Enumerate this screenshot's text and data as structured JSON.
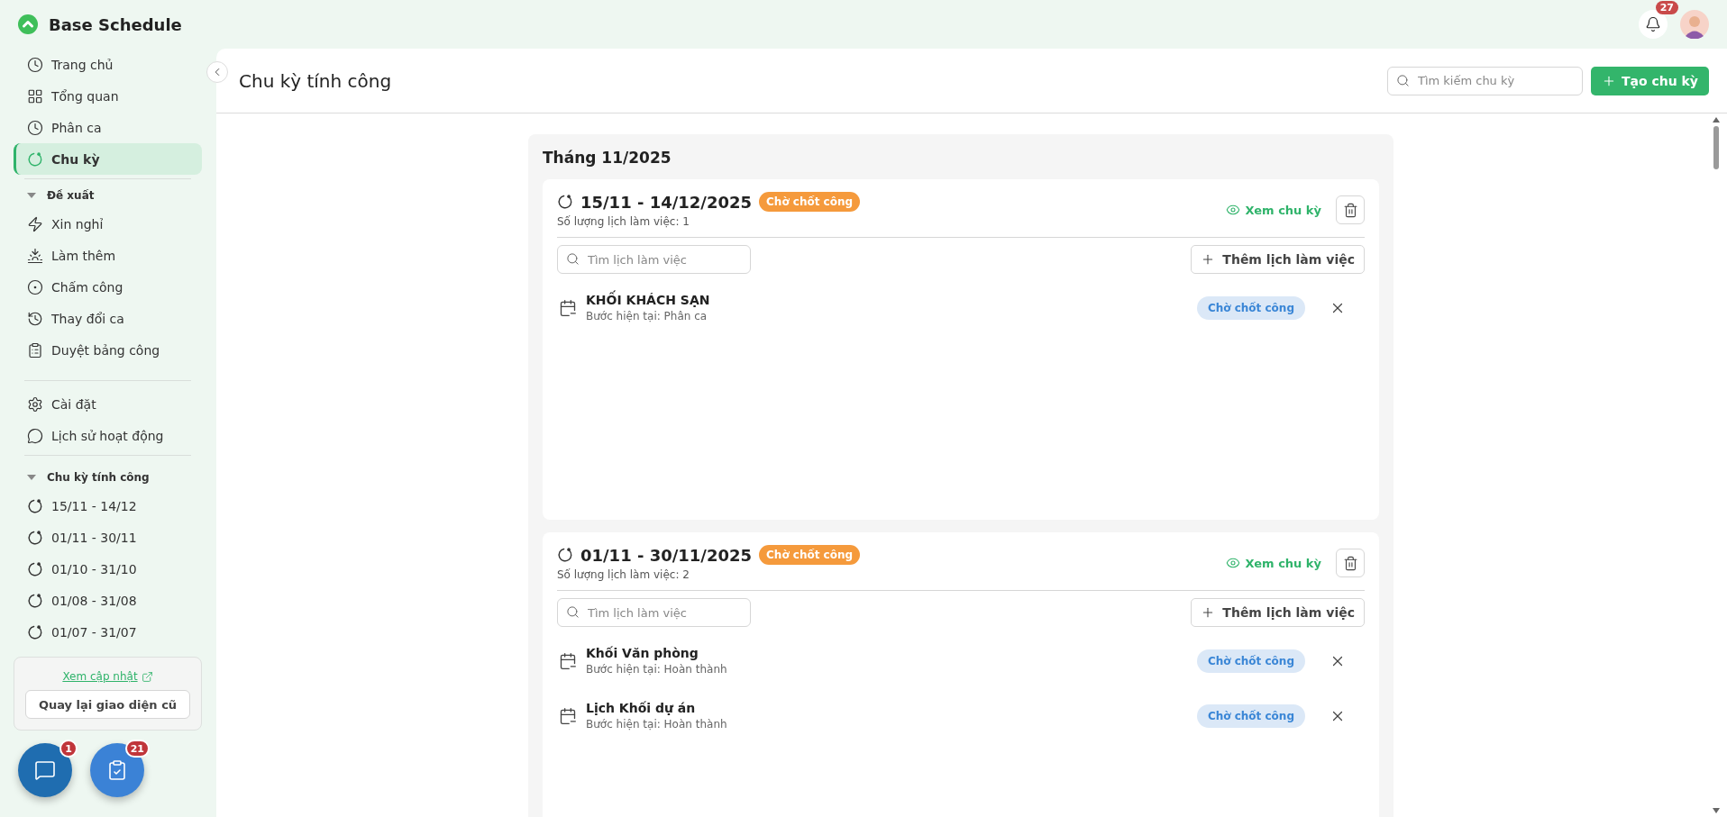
{
  "app": {
    "name": "Base Schedule"
  },
  "topbar": {
    "notification_count": "27"
  },
  "sidebar": {
    "nav": [
      {
        "label": "Trang chủ",
        "selected": false
      },
      {
        "label": "Tổng quan",
        "selected": false
      },
      {
        "label": "Phân ca",
        "selected": false
      },
      {
        "label": "Chu kỳ",
        "selected": true
      }
    ],
    "proposals": {
      "title": "Đề xuất",
      "expanded": true,
      "items": [
        {
          "label": "Xin nghỉ"
        },
        {
          "label": "Làm thêm"
        },
        {
          "label": "Chấm công"
        },
        {
          "label": "Thay đổi ca"
        },
        {
          "label": "Duyệt bảng công"
        }
      ]
    },
    "settings": [
      {
        "label": "Cài đặt"
      },
      {
        "label": "Lịch sử hoạt động"
      }
    ],
    "cycles": {
      "title": "Chu kỳ tính công",
      "expanded": true,
      "items": [
        {
          "label": "15/11 - 14/12"
        },
        {
          "label": "01/11 - 30/11"
        },
        {
          "label": "01/10 - 31/10"
        },
        {
          "label": "01/08 - 31/08"
        },
        {
          "label": "01/07 - 31/07"
        }
      ]
    },
    "update_box": {
      "link": "Xem cập nhật",
      "button": "Quay lại giao diện cũ"
    },
    "floating_buttons": [
      {
        "kind": "chat",
        "badge": "1"
      },
      {
        "kind": "tasks",
        "badge": "21"
      }
    ]
  },
  "main": {
    "title": "Chu kỳ tính công",
    "search": {
      "placeholder": "Tìm kiếm chu kỳ"
    },
    "create_button": "Tạo chu kỳ",
    "months": [
      {
        "title": "Tháng 11/2025",
        "cycles": [
          {
            "range": "15/11 - 14/12/2025",
            "status": "Chờ chốt công",
            "count": "Số lượng lịch làm việc: 1",
            "view": "Xem chu kỳ",
            "search_placeholder": "Tìm lịch làm việc",
            "add_button": "Thêm lịch làm việc",
            "schedules": [
              {
                "name": "KHỐI KHÁCH SẠN",
                "step": "Bước hiện tại: Phân ca",
                "status": "Chờ chốt công"
              }
            ]
          },
          {
            "range": "01/11 - 30/11/2025",
            "status": "Chờ chốt công",
            "count": "Số lượng lịch làm việc: 2",
            "view": "Xem chu kỳ",
            "search_placeholder": "Tìm lịch làm việc",
            "add_button": "Thêm lịch làm việc",
            "schedules": [
              {
                "name": "Khối Văn phòng",
                "step": "Bước hiện tại: Hoàn thành",
                "status": "Chờ chốt công"
              },
              {
                "name": "Lịch Khối dự án",
                "step": "Bước hiện tại: Hoàn thành",
                "status": "Chờ chốt công"
              }
            ]
          }
        ]
      }
    ]
  }
}
